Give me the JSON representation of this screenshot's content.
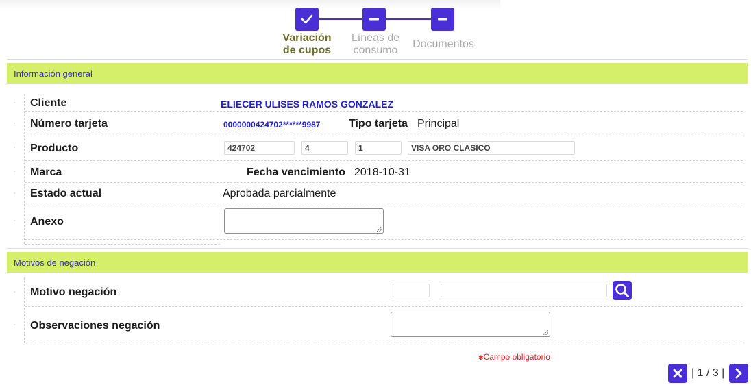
{
  "stepper": {
    "steps": [
      {
        "label_line1": "Variación",
        "label_line2": "de cupos",
        "state": "done"
      },
      {
        "label_line1": "Líneas de",
        "label_line2": "consumo",
        "state": "pending"
      },
      {
        "label_line1": "Documentos",
        "label_line2": "",
        "state": "pending"
      }
    ]
  },
  "info_general": {
    "title": "Información general",
    "cliente": {
      "label": "Cliente",
      "value": "ELIECER ULISES RAMOS GONZALEZ"
    },
    "numero_tarjeta": {
      "label": "Número tarjeta",
      "value": "0000000424702******9987"
    },
    "tipo_tarjeta": {
      "label": "Tipo tarjeta",
      "value": "Principal"
    },
    "producto": {
      "label": "Producto",
      "fields": [
        "424702",
        "4",
        "1",
        "VISA ORO CLASICO"
      ]
    },
    "marca": {
      "label": "Marca",
      "value": ""
    },
    "fecha_vencimiento": {
      "label": "Fecha vencimiento",
      "value": "2018-10-31"
    },
    "estado_actual": {
      "label": "Estado actual",
      "value": "Aprobada parcialmente"
    },
    "anexo": {
      "label": "Anexo",
      "value": ""
    }
  },
  "motivos": {
    "title": "Motivos de negación",
    "motivo": {
      "label": "Motivo negación",
      "code": "",
      "description": ""
    },
    "observaciones": {
      "label": "Observaciones negación",
      "value": ""
    }
  },
  "footer": {
    "required_note": "Campo obligatorio",
    "required_mark": "✱",
    "pager": "| 1 / 3 |"
  },
  "colors": {
    "accent": "#4a2fd6",
    "section_bar": "#d5ef6a",
    "required": "#e02020"
  },
  "icons": [
    "check-icon",
    "minus-icon",
    "search-icon",
    "close-icon",
    "chevron-right-icon"
  ]
}
